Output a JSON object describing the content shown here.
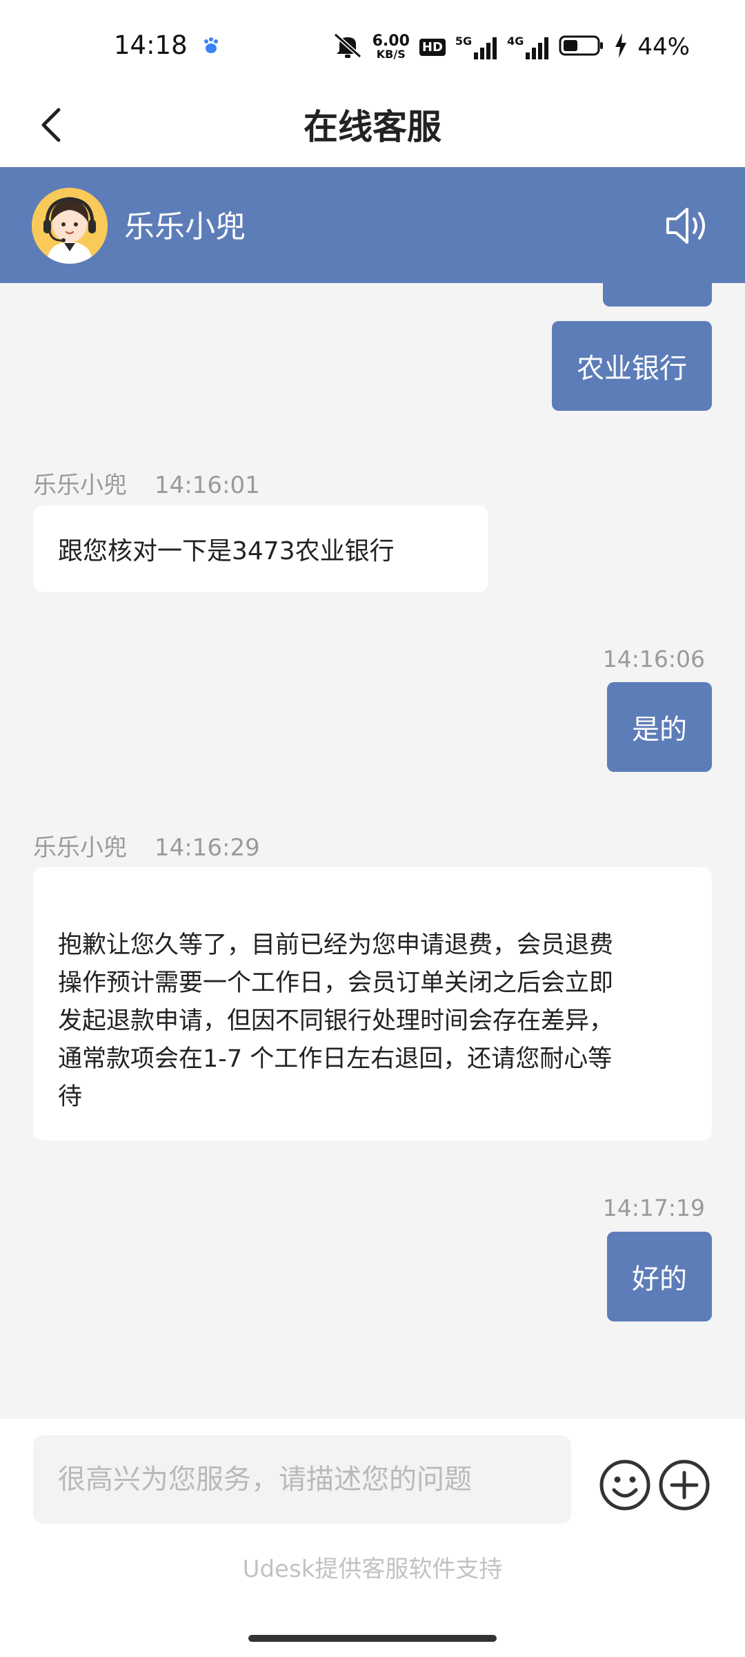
{
  "status_bar": {
    "time": "14:18",
    "net_speed_value": "6.00",
    "net_speed_unit": "KB/S",
    "hd_badge": "HD",
    "net_5g": "5G",
    "net_4g": "4G",
    "battery_percent": "44%",
    "battery_level": 0.44,
    "icons": [
      "baidu-icon",
      "mute-icon",
      "signal-5g-icon",
      "signal-4g-icon",
      "battery-icon",
      "charging-icon"
    ]
  },
  "header": {
    "title": "在线客服",
    "back_icon": "chevron-left-icon"
  },
  "agent": {
    "name": "乐乐小兜",
    "speaker_icon": "speaker-icon"
  },
  "messages": [
    {
      "side": "right",
      "text": "农业银行"
    },
    {
      "side": "left",
      "sender": "乐乐小兜",
      "time": "14:16:01",
      "text": "跟您核对一下是3473农业银行"
    },
    {
      "side": "right",
      "time": "14:16:06",
      "text": "是的"
    },
    {
      "side": "left",
      "sender": "乐乐小兜",
      "time": "14:16:29",
      "lines": [
        "抱歉让您久等了，目前已经为您申请退费，会员退费",
        "操作预计需要一个工作日，会员订单关闭之后会立即",
        "发起退款申请，但因不同银行处理时间会存在差异，",
        "通常款项会在1-7 个工作日左右退回，还请您耐心等",
        "待"
      ]
    },
    {
      "side": "right",
      "time": "14:17:19",
      "text": "好的"
    }
  ],
  "input": {
    "placeholder": "很高兴为您服务，请描述您的问题",
    "emoji_icon": "emoji-icon",
    "plus_icon": "plus-icon"
  },
  "footer": {
    "powered_by": "Udesk提供客服软件支持"
  },
  "colors": {
    "brand": "#5d7db8",
    "background": "#f4f4f5",
    "bubble_left": "#ffffff"
  }
}
